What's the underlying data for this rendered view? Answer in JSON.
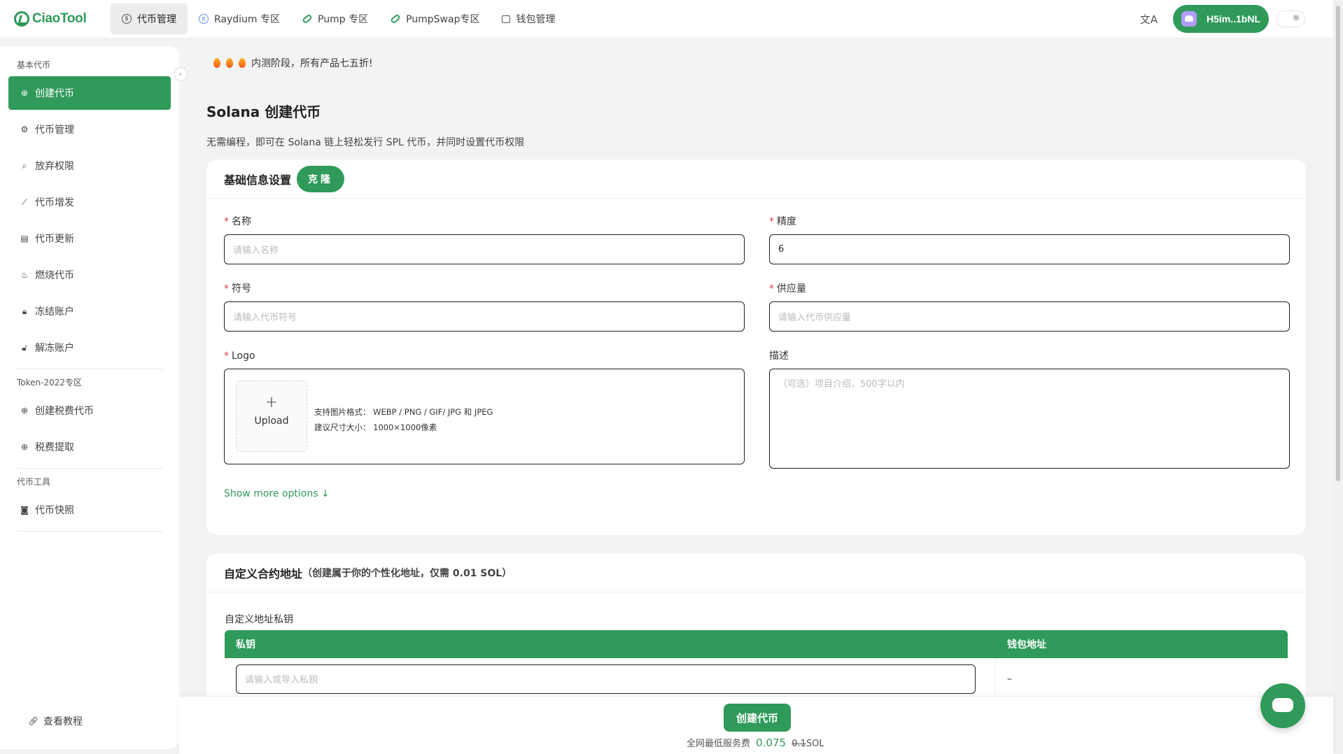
{
  "brand": {
    "logo_text_a": "Ciao",
    "logo_text_b": "Tool"
  },
  "nav": [
    {
      "label": "代币管理",
      "icon": "coin-icon",
      "active": true
    },
    {
      "label": "Raydium 专区",
      "icon": "raydium-icon"
    },
    {
      "label": "Pump 专区",
      "icon": "pill-icon"
    },
    {
      "label": "PumpSwap专区",
      "icon": "pill-icon"
    },
    {
      "label": "钱包管理",
      "icon": "wallet-icon"
    }
  ],
  "header": {
    "wallet_address": "H5im..1bNL"
  },
  "sidebar": {
    "group_basic": "基本代币",
    "basic_items": [
      {
        "label": "创建代币",
        "icon": "plus-circle-icon",
        "active": true
      },
      {
        "label": "代币管理",
        "icon": "gears-icon"
      },
      {
        "label": "放弃权限",
        "icon": "search-icon"
      },
      {
        "label": "代币增发",
        "icon": "chart-icon"
      },
      {
        "label": "代币更新",
        "icon": "doc-icon"
      },
      {
        "label": "燃烧代币",
        "icon": "flame-icon"
      },
      {
        "label": "冻结账户",
        "icon": "lock-icon"
      },
      {
        "label": "解冻账户",
        "icon": "unlock-icon"
      }
    ],
    "group_2022": "Token-2022专区",
    "items_2022": [
      {
        "label": "创建税费代币",
        "icon": "plus-circle-icon"
      },
      {
        "label": "税费提取",
        "icon": "plus-circle-icon"
      }
    ],
    "group_tools": "代币工具",
    "tool_items": [
      {
        "label": "代币快照",
        "icon": "camera-icon"
      }
    ],
    "tutorial": "查看教程"
  },
  "notice": "内测阶段，所有产品七五折!",
  "page": {
    "title": "Solana 创建代币",
    "subtitle": "无需编程，即可在 Solana 链上轻松发行 SPL 代币，并同时设置代币权限"
  },
  "basic_card": {
    "title": "基础信息设置",
    "clone_label": "克隆",
    "name_label": "名称",
    "name_placeholder": "请输入名称",
    "decimals_label": "精度",
    "decimals_value": "6",
    "symbol_label": "符号",
    "symbol_placeholder": "请输入代币符号",
    "supply_label": "供应量",
    "supply_placeholder": "请输入代币供应量",
    "logo_label": "Logo",
    "upload_label": "Upload",
    "upload_formats": "支持图片格式：  WEBP / PNG / GIF/ JPG 和 JPEG",
    "upload_size": "建议尺寸大小：  1000×1000像素",
    "desc_label": "描述",
    "desc_placeholder": "（可选）项目介绍，500字以内",
    "show_more": "Show more options ↓"
  },
  "custom_card": {
    "title": "自定义合约地址",
    "note": "（创建属于你的个性化地址，仅需 0.01 SOL）",
    "pk_label": "自定义地址私钥",
    "col_private_key": "私钥",
    "col_wallet": "钱包地址",
    "pk_placeholder": "请输入或导入私钥",
    "wallet_value": "–"
  },
  "footer": {
    "create_label": "创建代币",
    "fee_prefix": "全网最低服务费",
    "fee_price": "0.075",
    "fee_old": "0.1",
    "fee_unit": "SOL"
  },
  "colors": {
    "accent": "#2f9a5a",
    "required": "#e03c3c"
  }
}
